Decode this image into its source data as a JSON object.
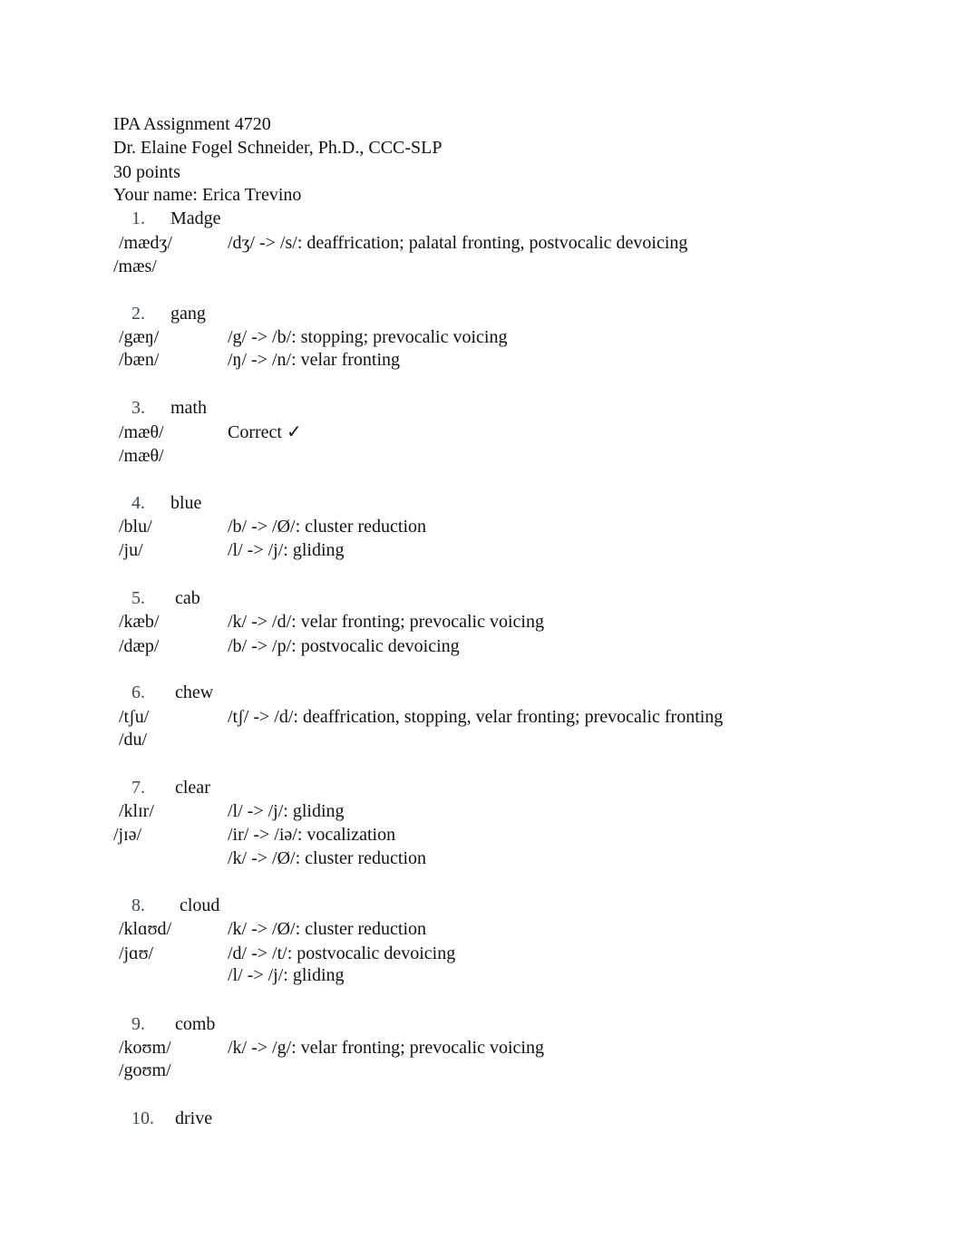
{
  "header": {
    "title": "IPA Assignment 4720",
    "instructor": "Dr. Elaine Fogel Schneider, Ph.D., CCC-SLP",
    "points": "30 points",
    "student": "Your name: Erica Trevino"
  },
  "items": [
    {
      "num": "1.",
      "word": "Madge",
      "target": "/mædʒ/",
      "production": "/mæs/",
      "analysis": [
        "/dʒ/ -> /s/: deaffrication; palatal fronting, postvocalic devoicing"
      ]
    },
    {
      "num": "2.",
      "word": "gang",
      "target": "/gæŋ/",
      "production": "/bæn/",
      "analysis": [
        "/g/ -> /b/: stopping; prevocalic voicing",
        "/ŋ/ -> /n/: velar fronting"
      ]
    },
    {
      "num": "3.",
      "word": "math",
      "target": "/mæθ/",
      "production": "/mæθ/",
      "analysis": [
        "Correct ✓"
      ]
    },
    {
      "num": "4.",
      "word": "blue",
      "target": "/blu/",
      "production": "/ju/",
      "analysis": [
        "/b/ -> /Ø/: cluster reduction",
        "/l/ -> /j/: gliding"
      ]
    },
    {
      "num": "5.",
      "word": "cab",
      "target": "/kæb/",
      "production": "/dæp/",
      "analysis": [
        "/k/ -> /d/: velar fronting; prevocalic voicing",
        "/b/ -> /p/: postvocalic devoicing"
      ]
    },
    {
      "num": "6.",
      "word": "chew",
      "target": "/tʃu/",
      "production": "/du/",
      "analysis": [
        "/tʃ/ -> /d/: deaffrication, stopping, velar fronting; prevocalic fronting"
      ]
    },
    {
      "num": "7.",
      "word": "clear",
      "target": "/klɪr/",
      "production": "/jɪə/",
      "analysis": [
        "/l/ -> /j/: gliding",
        "/ir/ -> /iə/: vocalization",
        "/k/ -> /Ø/: cluster reduction"
      ]
    },
    {
      "num": "8.",
      "word": "cloud",
      "target": "/klɑʊd/",
      "production": "/jɑʊ/",
      "analysis": [
        "/k/ -> /Ø/: cluster reduction",
        "/d/ -> /t/: postvocalic devoicing",
        "/l/ -> /j/: gliding"
      ]
    },
    {
      "num": "9.",
      "word": "comb",
      "target": "/koʊm/",
      "production": "/goʊm/",
      "analysis": [
        "/k/ -> /g/: velar fronting; prevocalic voicing"
      ]
    },
    {
      "num": "10.",
      "word": "drive"
    }
  ]
}
